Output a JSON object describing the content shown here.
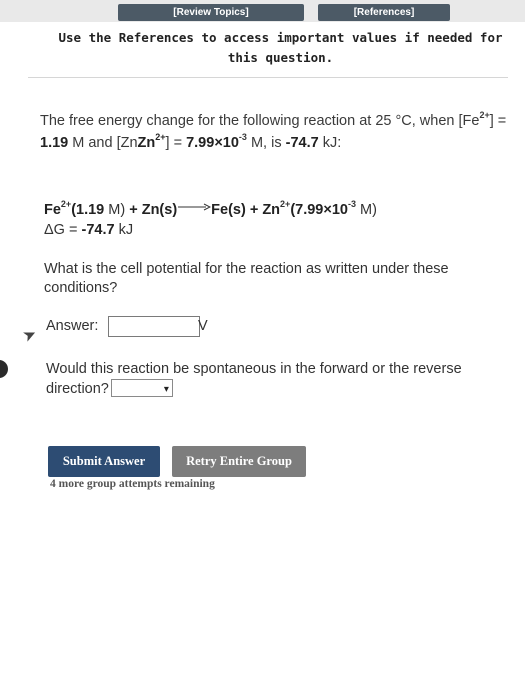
{
  "tabs": {
    "review": "[Review Topics]",
    "references": "[References]"
  },
  "notice": "Use the References to access important values if needed for this question.",
  "problem": {
    "p1_a": "The free energy change for the following reaction at 25 °C, when [Fe",
    "p1_sup1": "2+",
    "p1_b": "] = ",
    "fe_conc": "1.19",
    "p1_c": " M and [Zn",
    "p1_sup2": "2+",
    "p1_d": "] = ",
    "zn_conc": "7.99×10",
    "zn_exp": "-3",
    "p1_e": " M, is ",
    "dg_value": "-74.7",
    "p1_f": " kJ:"
  },
  "reaction": {
    "fe": "Fe",
    "fe_charge": "2+",
    "fe_conc": "(1.19",
    "m1": " M)",
    "plus1": " + Zn(s)",
    "products": "Fe(s) + Zn",
    "zn_charge": "2+",
    "zn_conc": "(7.99×10",
    "zn_exp": "-3",
    "m2": " M)",
    "dg_label": "ΔG = ",
    "dg_value": "-74.7",
    "dg_unit": " kJ"
  },
  "question1": "What is the cell potential for the reaction as written under these conditions?",
  "answer": {
    "label": "Answer:",
    "value": "",
    "unit": "V"
  },
  "question2": "Would this reaction be spontaneous in the forward or the reverse direction?",
  "select": {
    "value": "",
    "caret": "▾"
  },
  "buttons": {
    "submit": "Submit Answer",
    "retry": "Retry Entire Group"
  },
  "attempts": "4 more group attempts remaining",
  "icons": {
    "cursor": "pointer-cursor-icon",
    "dropdown": "chevron-down-icon"
  }
}
